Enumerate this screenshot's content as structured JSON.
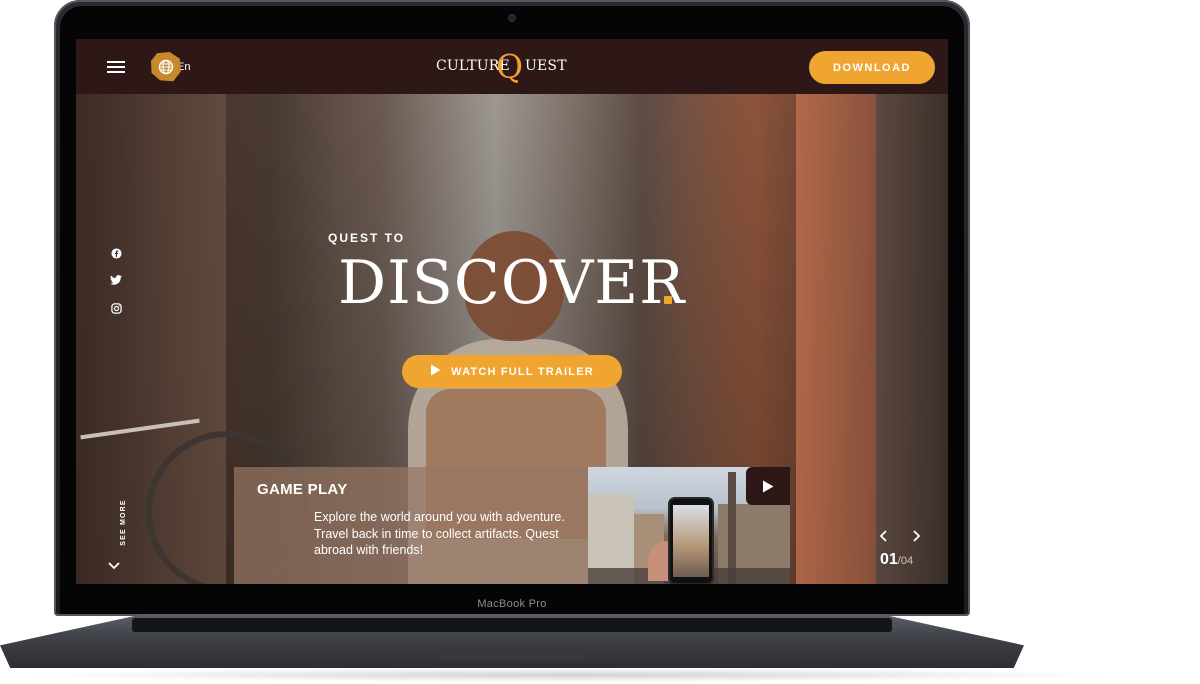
{
  "device": {
    "model_label": "MacBook Pro"
  },
  "header": {
    "language": "En",
    "logo": {
      "left": "CULTURE",
      "letter": "Q",
      "right": "UEST"
    },
    "download_label": "DOWNLOAD"
  },
  "hero": {
    "kicker": "QUEST TO",
    "headline": "DISCOVER",
    "trailer_label": "WATCH FULL TRAILER"
  },
  "social": [
    "facebook-icon",
    "twitter-icon",
    "instagram-icon"
  ],
  "see_more_label": "SEE MORE",
  "gameplay": {
    "title": "GAME PLAY",
    "description": "Explore the world around you with adventure.  Travel back in time to collect artifacts.  Quest abroad with friends!"
  },
  "pager": {
    "current": "01",
    "total": "/04"
  },
  "colors": {
    "accent": "#f0a530",
    "header_bg": "#2e1717",
    "card_bg": "#967662"
  }
}
